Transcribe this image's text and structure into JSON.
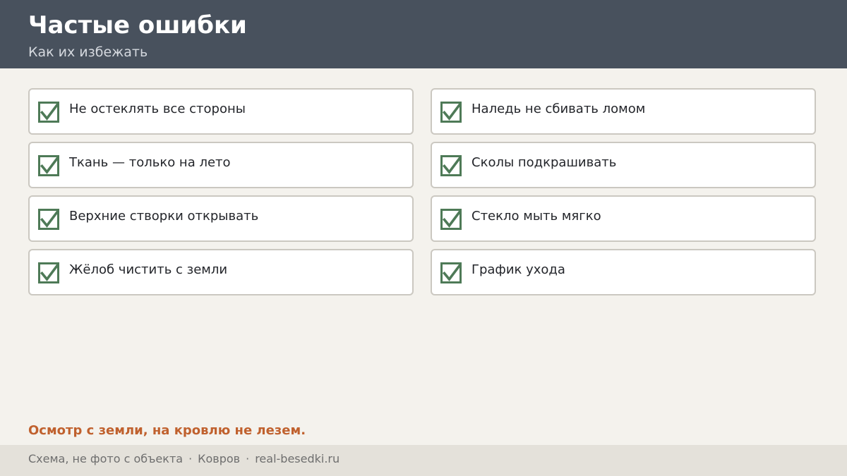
{
  "header": {
    "title": "Частые ошибки",
    "subtitle": "Как их избежать"
  },
  "items": [
    {
      "label": "Не остеклять все стороны",
      "checked": true
    },
    {
      "label": "Наледь не сбивать ломом",
      "checked": true
    },
    {
      "label": "Ткань — только на лето",
      "checked": true
    },
    {
      "label": "Сколы подкрашивать",
      "checked": true
    },
    {
      "label": "Верхние створки открывать",
      "checked": true
    },
    {
      "label": "Стекло мыть мягко",
      "checked": true
    },
    {
      "label": "Жёлоб чистить с земли",
      "checked": true
    },
    {
      "label": "График ухода",
      "checked": true
    }
  ],
  "note": "Осмотр с земли, на кровлю не лезем.",
  "footer": {
    "caption": "Схема, не фото с объекта",
    "city": "Ковров",
    "site": "real-besedki.ru",
    "separator": "·"
  },
  "colors": {
    "header_bg": "#48515d",
    "check_green": "#4e7a57",
    "note_orange": "#c0612e",
    "page_bg": "#f4f2ed",
    "footer_bg": "#e4e1da"
  },
  "icons": {
    "check": "checked-box-icon"
  }
}
